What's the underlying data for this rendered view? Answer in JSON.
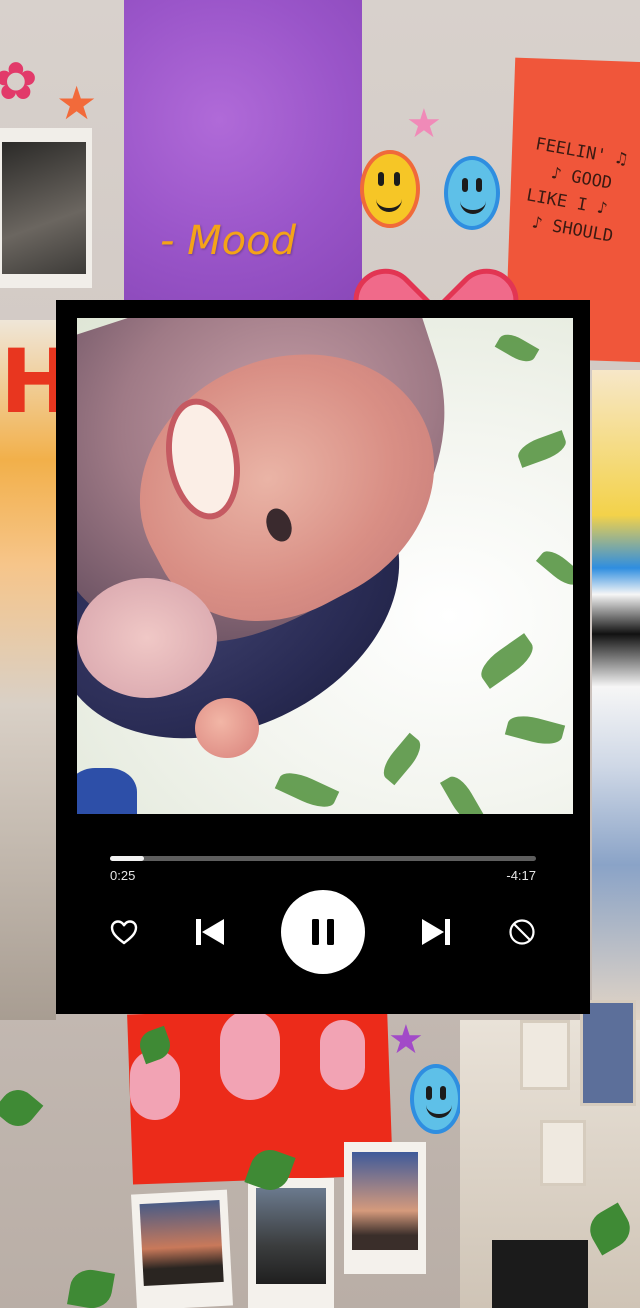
{
  "song": {
    "title": "- Mood"
  },
  "player": {
    "elapsed": "0:25",
    "remaining": "-4:17",
    "progress": 0.08,
    "state": "playing"
  },
  "controls": {
    "like_icon": "heart-icon",
    "previous_icon": "skip-previous-icon",
    "pause_icon": "pause-icon",
    "next_icon": "skip-next-icon",
    "block_icon": "block-icon"
  },
  "decor": {
    "poster_text": "FEELIN' ♫\n  ♪ GOOD\nLIKE I ♪\n ♪ SHOULD",
    "wall_letters": "Hi",
    "colors": {
      "title": "#f4a318",
      "player_bg": "#000000",
      "track": "#5e5e5e",
      "fill": "#f2f2f2"
    }
  }
}
